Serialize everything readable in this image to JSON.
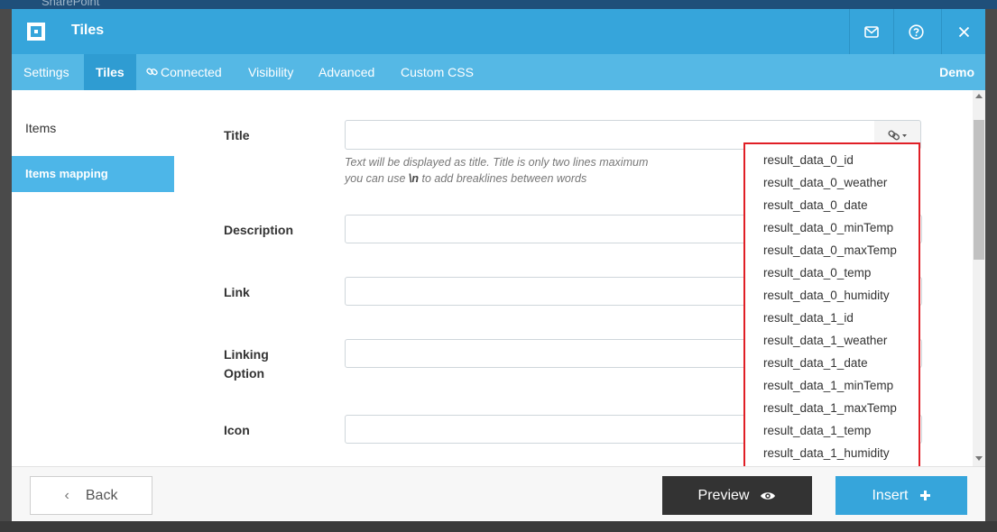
{
  "background": {
    "topbar_text": "SharePoint"
  },
  "header": {
    "title": "Tiles",
    "icons": [
      "logo-icon",
      "mail-icon",
      "help-icon",
      "close-icon"
    ]
  },
  "tabs": [
    {
      "label": "Settings",
      "active": false
    },
    {
      "label": "Tiles",
      "active": true
    },
    {
      "label": "Connected",
      "active": false,
      "icon": "link-icon"
    },
    {
      "label": "Visibility",
      "active": false
    },
    {
      "label": "Advanced",
      "active": false
    },
    {
      "label": "Custom CSS",
      "active": false
    }
  ],
  "tab_right_label": "Demo",
  "sidebar": {
    "items": [
      {
        "label": "Items",
        "active": false
      },
      {
        "label": "Items mapping",
        "active": true
      }
    ]
  },
  "form": {
    "fields": [
      {
        "label": "Title",
        "value": ""
      },
      {
        "label": "Description",
        "value": ""
      },
      {
        "label": "Link",
        "value": ""
      },
      {
        "label_line1": "Linking",
        "label_line2": "Option",
        "value": ""
      },
      {
        "label": "Icon",
        "value": ""
      }
    ],
    "title_help_line1": "Text will be displayed as title. Title is only two lines maximum",
    "title_help_line2_prefix": "you can use ",
    "title_help_line2_code": "\\n",
    "title_help_line2_suffix": " to add breaklines between words"
  },
  "dropdown": {
    "highlight_color": "#e01f26",
    "options": [
      "result_data_0_id",
      "result_data_0_weather",
      "result_data_0_date",
      "result_data_0_minTemp",
      "result_data_0_maxTemp",
      "result_data_0_temp",
      "result_data_0_humidity",
      "result_data_1_id",
      "result_data_1_weather",
      "result_data_1_date",
      "result_data_1_minTemp",
      "result_data_1_maxTemp",
      "result_data_1_temp",
      "result_data_1_humidity"
    ]
  },
  "footer": {
    "back_label": "Back",
    "preview_label": "Preview",
    "insert_label": "Insert"
  },
  "colors": {
    "accent": "#36a5db",
    "tabbar": "#55b8e5",
    "active_tab": "#2f9cd2",
    "dark_button": "#333333"
  }
}
